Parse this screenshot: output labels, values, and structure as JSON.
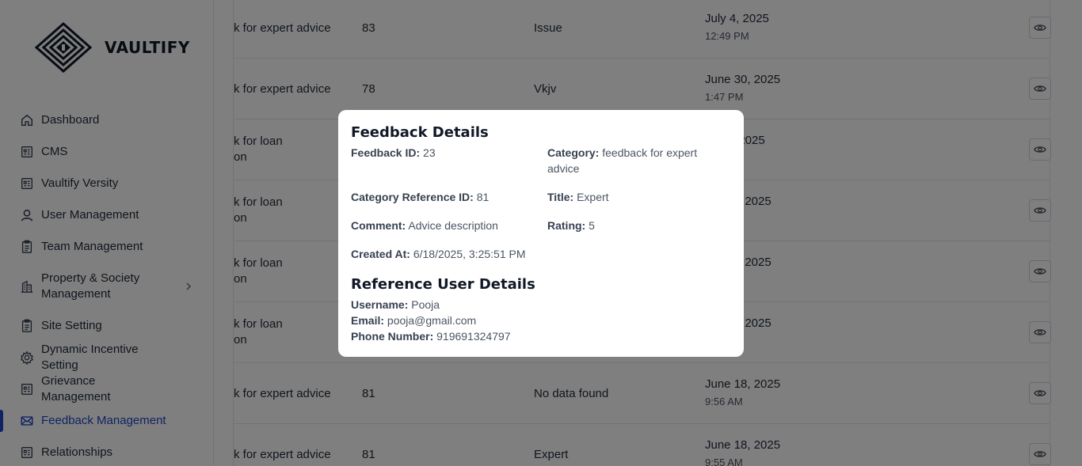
{
  "brand": {
    "name": "VAULTIFY"
  },
  "sidebar": {
    "items": [
      {
        "label": "Dashboard",
        "icon": "home-icon"
      },
      {
        "label": "CMS",
        "icon": "id-card-icon"
      },
      {
        "label": "Vaultify Versity",
        "icon": "id-card-icon"
      },
      {
        "label": "User Management",
        "icon": "user-icon"
      },
      {
        "label": "Team Management",
        "icon": "clipboard-icon"
      },
      {
        "label": "Property & Society Management",
        "icon": "building-icon",
        "has_submenu": true
      },
      {
        "label": "Site Setting",
        "icon": "clipboard-icon"
      },
      {
        "label": "Dynamic Incentive Setting",
        "icon": "gear-icon"
      },
      {
        "label": "Grievance Management",
        "icon": "id-card-icon"
      },
      {
        "label": "Feedback Management",
        "icon": "mail-icon",
        "active": true
      },
      {
        "label": "Relationships",
        "icon": "id-card-icon"
      }
    ],
    "active_color": "#2046c7"
  },
  "table": {
    "rows": [
      {
        "category": "k for expert advice",
        "ref_id": "83",
        "title": "Issue",
        "date": "July 4, 2025",
        "time": "12:49 PM"
      },
      {
        "category": "k for expert advice",
        "ref_id": "78",
        "title": "Vkjv",
        "date": "June 30, 2025",
        "time": "1:47 PM"
      },
      {
        "category_line1": "k for loan",
        "category_line2": "on",
        "date": ", 2025"
      },
      {
        "category_line1": "k for loan",
        "category_line2": "on",
        "date": ", 2025"
      },
      {
        "category_line1": "k for loan",
        "category_line2": "on",
        "date": ", 2025"
      },
      {
        "category_line1": "k for loan",
        "category_line2": "on",
        "date": ", 2025"
      },
      {
        "category": "k for expert advice",
        "ref_id": "81",
        "title": "No data found",
        "date": "June 18, 2025",
        "time": "9:56 AM"
      },
      {
        "category": "k for expert advice",
        "ref_id": "81",
        "title": "Expert",
        "date": "June 18, 2025",
        "time": "9:55 AM"
      }
    ]
  },
  "modal": {
    "title": "Feedback Details",
    "feedback_id_label": "Feedback ID:",
    "feedback_id": "23",
    "category_label": "Category:",
    "category": "feedback for expert advice",
    "category_ref_label": "Category Reference ID:",
    "category_ref": "81",
    "title_label": "Title:",
    "title_value": "Expert",
    "comment_label": "Comment:",
    "comment": "Advice description",
    "rating_label": "Rating:",
    "rating": "5",
    "created_label": "Created At:",
    "created": "6/18/2025, 3:25:51 PM",
    "ref_user_title": "Reference User Details",
    "username_label": "Username:",
    "username": "Pooja",
    "email_label": "Email:",
    "email": "pooja@gmail.com",
    "phone_label": "Phone Number:",
    "phone": "919691324797"
  }
}
